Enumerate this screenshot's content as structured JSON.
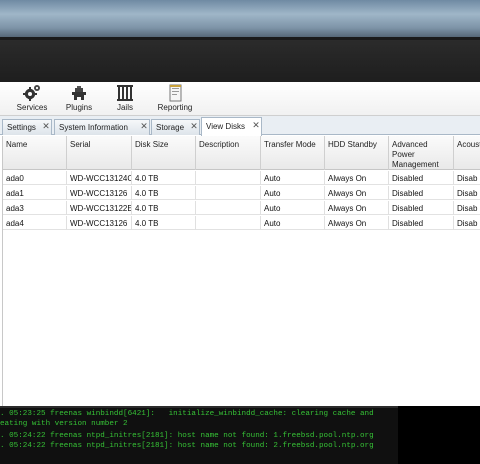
{
  "toolbar": {
    "buttons": [
      {
        "label": "Services",
        "icon": "services-gear-icon"
      },
      {
        "label": "Plugins",
        "icon": "plugins-icon"
      },
      {
        "label": "Jails",
        "icon": "jails-bars-icon"
      },
      {
        "label": "Reporting",
        "icon": "reporting-document-icon"
      }
    ]
  },
  "tabs": [
    {
      "label": "Settings",
      "close": "✕"
    },
    {
      "label": "System Information",
      "close": "✕"
    },
    {
      "label": "Storage",
      "close": "✕"
    },
    {
      "label": "View Disks",
      "close": "✕",
      "active": true
    }
  ],
  "grid": {
    "columns": [
      "Name",
      "Serial",
      "Disk Size",
      "Description",
      "Transfer Mode",
      "HDD Standby",
      "Advanced Power Management",
      "Acoustic"
    ],
    "column_display": [
      "Name",
      "Serial",
      "Disk Size",
      "Description",
      "Transfer Mode",
      "HDD Standby",
      "Advanced\nPower\nManagement",
      "Acoust"
    ],
    "rows": [
      [
        "ada0",
        "WD-WCC13124C",
        "4.0 TB",
        "",
        "Auto",
        "Always On",
        "Disabled",
        "Disab"
      ],
      [
        "ada1",
        "WD-WCC13126",
        "4.0 TB",
        "",
        "Auto",
        "Always On",
        "Disabled",
        "Disab"
      ],
      [
        "ada3",
        "WD-WCC13122E",
        "4.0 TB",
        "",
        "Auto",
        "Always On",
        "Disabled",
        "Disab"
      ],
      [
        "ada4",
        "WD-WCC13126",
        "4.0 TB",
        "",
        "Auto",
        "Always On",
        "Disabled",
        "Disab"
      ]
    ]
  },
  "console": {
    "lines": [
      ". 05:23:25 freenas winbindd[6421]:   initialize_winbindd_cache: clearing cache and",
      "eating with version number 2",
      ". 05:24:22 freenas ntpd_initres[2181]: host name not found: 1.freebsd.pool.ntp.org",
      ". 05:24:22 freenas ntpd_initres[2181]: host name not found: 2.freebsd.pool.ntp.org"
    ],
    "text_color": "#36c236"
  },
  "colors": {
    "header_bg": "#1e1e1e",
    "tab_border": "#a9b8c7",
    "console_bg": "#101010"
  }
}
